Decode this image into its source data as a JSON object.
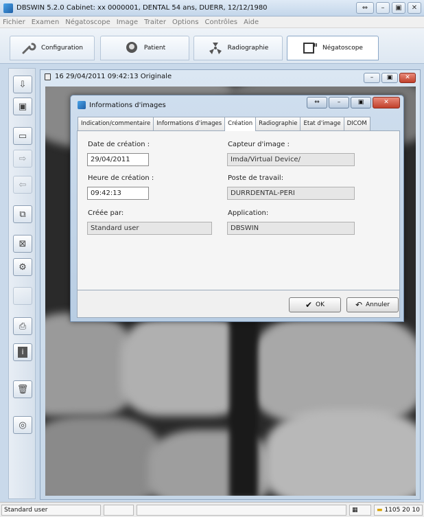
{
  "window": {
    "title": "DBSWIN 5.2.0     Cabinet: xx      0000001, DENTAL  54 ans, DUERR, 12/12/1980",
    "controls": [
      "⇔",
      "–",
      "▣",
      "✕"
    ]
  },
  "menu": [
    "Fichier",
    "Examen",
    "Négatoscope",
    "Image",
    "Traiter",
    "Options",
    "Contrôles",
    "Aide"
  ],
  "toolbar": {
    "tabs": [
      {
        "label": "Configuration",
        "icon": "wrench-icon"
      },
      {
        "label": "Patient",
        "icon": "patient-icon"
      },
      {
        "label": "Radiographie",
        "icon": "radiation-icon"
      },
      {
        "label": "Négatoscope",
        "icon": "viewer-icon"
      }
    ],
    "active_tab": "Négatoscope"
  },
  "sidebar": {
    "buttons": [
      "import-icon",
      "save-icon",
      "new-window-icon",
      "transfer-out-icon",
      "transfer-in-icon",
      "copy-icon",
      "frame-icon",
      "tools-icon",
      "blank-icon",
      "print-icon",
      "info-icon",
      "delete-icon",
      "disc-icon"
    ]
  },
  "image_window": {
    "title": "16 29/04/2011 09:42:13 Originale"
  },
  "dialog": {
    "title": "Informations d'images",
    "tabs": [
      "Indication/commentaire",
      "Informations d'images",
      "Création",
      "Radiographie",
      "Etat d'image",
      "DICOM"
    ],
    "active_tab": "Création",
    "fields": {
      "date_label": "Date de création :",
      "date_value": "29/04/2011",
      "time_label": "Heure de création :",
      "time_value": "09:42:13",
      "created_by_label": "Créée par:",
      "created_by_value": "Standard user",
      "capture_label": "Capteur d'image :",
      "capture_value": "Imda/Virtual Device/",
      "workstation_label": "Poste de travail:",
      "workstation_value": "DURRDENTAL-PERI",
      "application_label": "Application:",
      "application_value": "DBSWIN"
    },
    "ok_label": "OK",
    "cancel_label": "Annuler"
  },
  "status": {
    "user": "Standard user",
    "right_text": "1105 20 10"
  }
}
